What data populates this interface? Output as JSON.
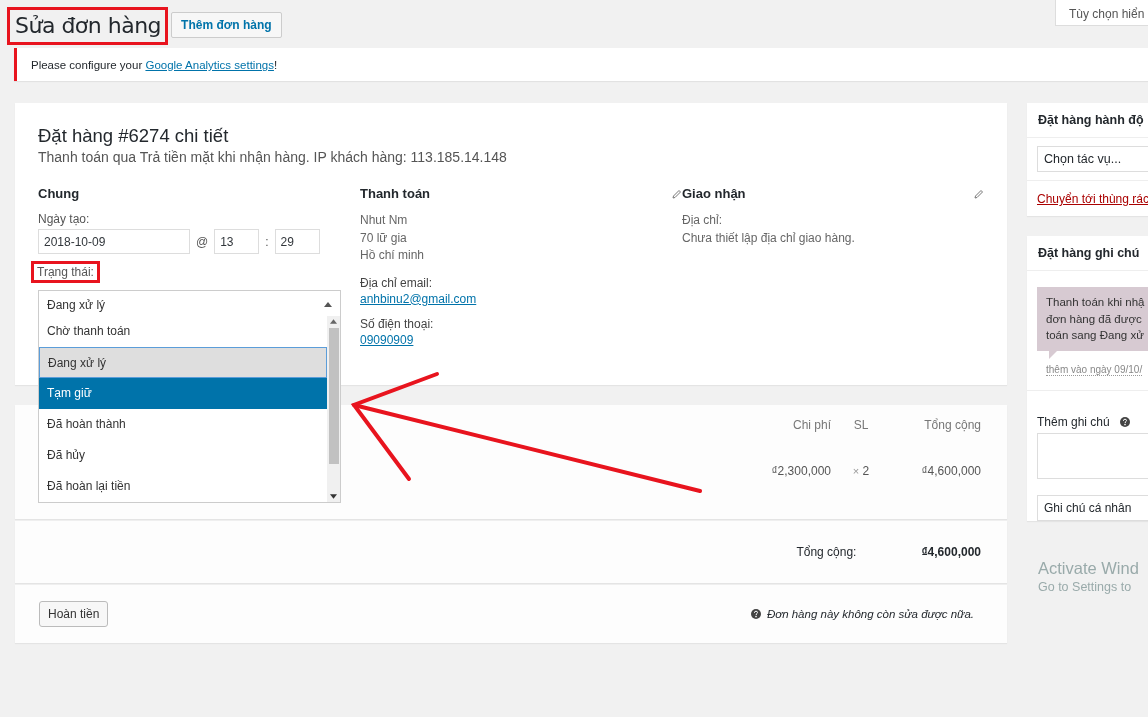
{
  "header": {
    "title": "Sửa đơn hàng",
    "add_button": "Thêm đơn hàng",
    "screen_options": "Tùy chọn hiển"
  },
  "notice": {
    "text": "Please configure your ",
    "link": "Google Analytics settings",
    "end": "!"
  },
  "order": {
    "title": "Đặt hàng #6274 chi tiết",
    "subtitle": "Thanh toán qua Trả tiền mặt khi nhận hàng. IP khách hàng: 113.185.14.148",
    "general": {
      "heading": "Chung",
      "date_label": "Ngày tạo:",
      "date": "2018-10-09",
      "at": "@",
      "hour": "13",
      "colon": ":",
      "minute": "29",
      "status_label": "Trạng thái:",
      "status_value": "Đang xử lý",
      "options": [
        {
          "label": "Chờ thanh toán",
          "current": false,
          "selected": false
        },
        {
          "label": "Đang xử lý",
          "current": true,
          "selected": false
        },
        {
          "label": "Tạm giữ",
          "current": false,
          "selected": true
        },
        {
          "label": "Đã hoàn thành",
          "current": false,
          "selected": false
        },
        {
          "label": "Đã hủy",
          "current": false,
          "selected": false
        },
        {
          "label": "Đã hoàn lại tiền",
          "current": false,
          "selected": false
        }
      ]
    },
    "billing": {
      "heading": "Thanh toán",
      "lines": [
        "Nhut Nm",
        "70 lữ gia",
        "Hồ chí minh"
      ],
      "email_label": "Địa chỉ email:",
      "email": "anhbinu2@gmail.com",
      "phone_label": "Số điện thoại:",
      "phone": "09090909"
    },
    "shipping": {
      "heading": "Giao nhận",
      "address_label": "Địa chỉ:",
      "address": "Chưa thiết lập địa chỉ giao hàng."
    }
  },
  "items": {
    "columns": [
      "Chi phí",
      "SL",
      "Tổng cộng"
    ],
    "rows": [
      {
        "cost": "₫2,300,000",
        "times": "×",
        "qty": "2",
        "total": "₫4,600,000"
      }
    ]
  },
  "totals": {
    "label": "Tổng cộng:",
    "value": "₫4,600,000"
  },
  "footer": {
    "refund_button": "Hoàn tiền",
    "note": "Đơn hàng này không còn sửa được nữa."
  },
  "sidebar": {
    "actions": {
      "title": "Đặt hàng hành độ",
      "select": "Chọn tác vụ...",
      "trash_link": "Chuyển tới thùng rác"
    },
    "notes": {
      "title": "Đặt hàng ghi chú",
      "note_lines": [
        "Thanh toán khi nhậ",
        "đơn hàng đã được",
        "toán sang Đang xử"
      ],
      "meta": "thêm vào ngày 09/10/",
      "add_label": "Thêm ghi chú",
      "note_type": "Ghi chú cá nhân"
    },
    "activation": {
      "title": "Activate Wind",
      "subtitle": "Go to Settings to"
    }
  }
}
